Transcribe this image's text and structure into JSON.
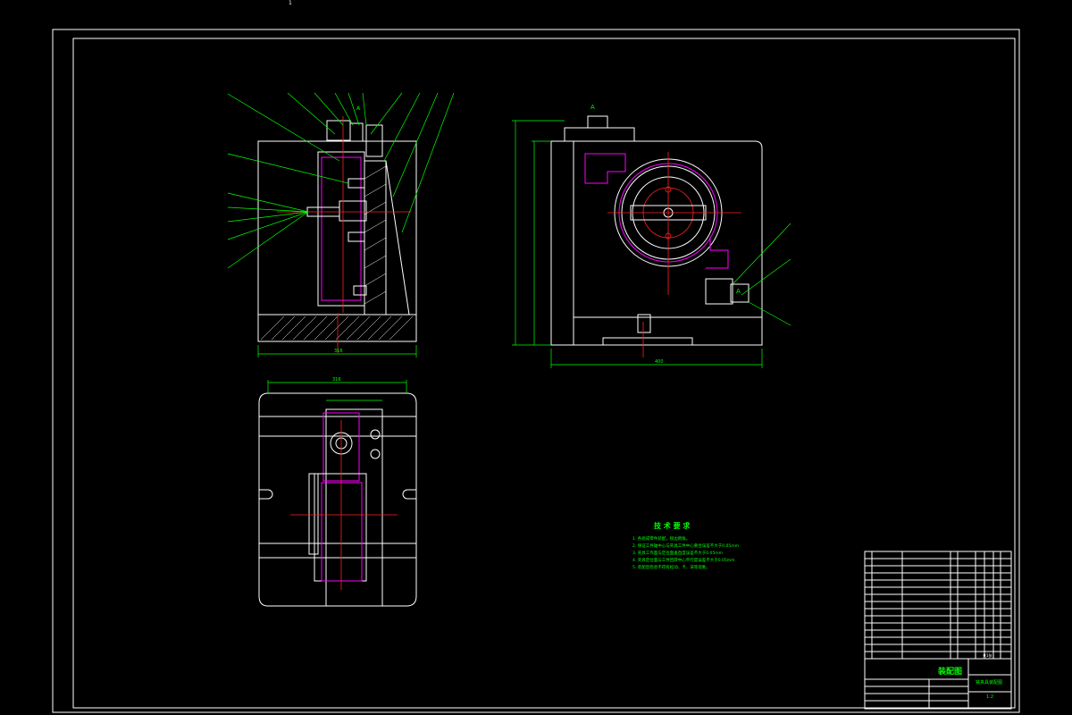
{
  "page_marker": "1",
  "colors": {
    "background": "#000000",
    "outline": "#ffffff",
    "annotation": "#00ff00",
    "hidden": "#ff00ff",
    "centerline": "#ff2020"
  },
  "tech_requirements": {
    "title": "技 术 要 求",
    "items": [
      "1. 各组成零件装配，锐边倒角。",
      "2. 保证工件轴中心与夹具工件中心重合误差不大于0.05mm",
      "3. 夹具工作面与定位面垂直度误差不大于0.05mm",
      "4. 夹具定位面与工件回转中心平行度误差不大于0.05mm",
      "5. 装配后检验不得有松动、卡、滞等现象。"
    ]
  },
  "title_block": {
    "drawing_name": "装配图",
    "company": "铣夹具装配图",
    "scale": "1:2",
    "sheet": "共1张"
  },
  "views": {
    "front_label": "A",
    "side_label": "A"
  }
}
